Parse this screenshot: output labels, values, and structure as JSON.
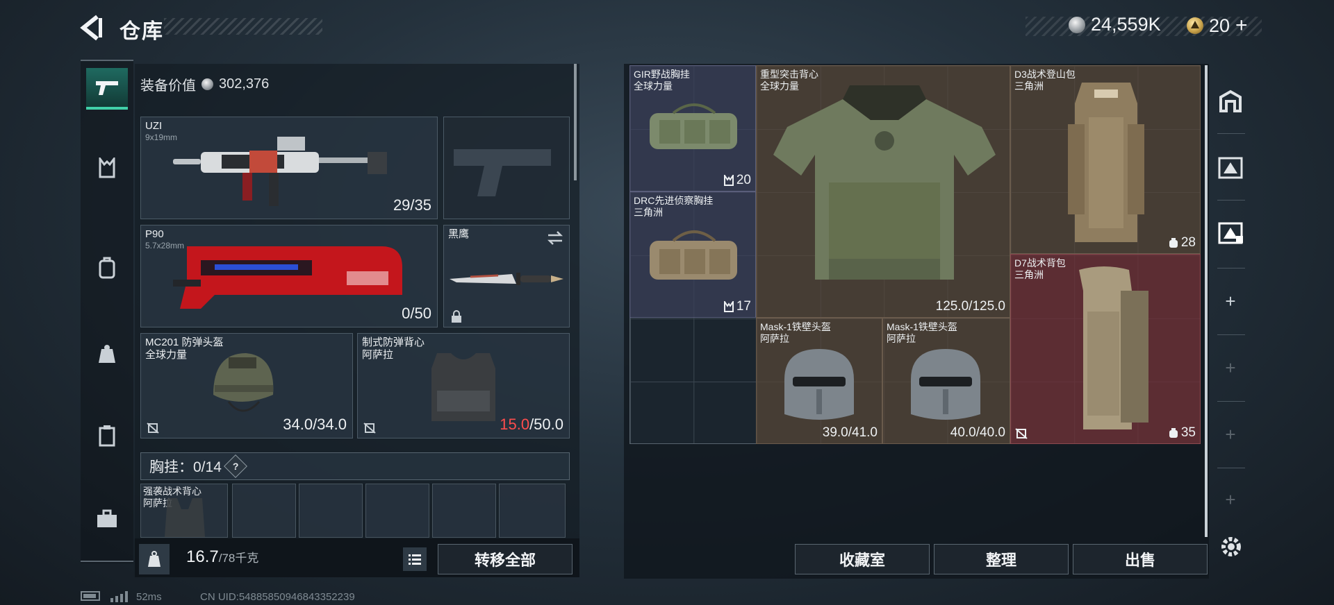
{
  "header": {
    "title": "仓库",
    "silver": "24,559K",
    "gold": "20",
    "plus": "+"
  },
  "left_nav": [
    "pistol-icon",
    "chest-rig-icon",
    "backpack-icon",
    "pouch-icon",
    "card-icon",
    "toolbox-icon"
  ],
  "equipment": {
    "value_label": "装备价值",
    "value": "302,376",
    "uzi": {
      "name": "UZI",
      "ammo": "9x19mm",
      "durability": "29/35"
    },
    "p90": {
      "name": "P90",
      "ammo": "5.7x28mm",
      "durability": "0/50"
    },
    "knife": {
      "name": "黑鹰"
    },
    "helmet": {
      "name": "MC201 防弹头盔",
      "faction": "全球力量",
      "durability": "34.0/34.0"
    },
    "armor": {
      "name": "制式防弹背心",
      "faction": "阿萨拉",
      "durability_cur": "15.0",
      "durability_max": "/50.0"
    },
    "vest_label": "胸挂：0/14",
    "vest_help": "?",
    "vest_item": {
      "name": "强袭战术背心",
      "faction": "阿萨拉"
    },
    "weight": "16.7",
    "weight_max": "/78千克",
    "transfer_all": "转移全部"
  },
  "storage": {
    "gir": {
      "name": "GIR野战胸挂",
      "faction": "全球力量",
      "count": "20"
    },
    "drc": {
      "name": "DRC先进侦察胸挂",
      "faction": "三角洲",
      "count": "17"
    },
    "heavy_vest": {
      "name": "重型突击背心",
      "faction": "全球力量",
      "durability": "125.0/125.0"
    },
    "d3": {
      "name": "D3战术登山包",
      "faction": "三角洲",
      "count": "28"
    },
    "d7": {
      "name": "D7战术背包",
      "faction": "三角洲",
      "count": "35"
    },
    "mask1": {
      "name": "Mask-1铁壁头盔",
      "faction": "阿萨拉",
      "durability": "39.0/41.0"
    },
    "mask2": {
      "name": "Mask-1铁壁头盔",
      "faction": "阿萨拉",
      "durability": "40.0/40.0"
    }
  },
  "actions": {
    "collection": "收藏室",
    "organize": "整理",
    "sell": "出售"
  },
  "right_nav": {
    "add": "+"
  },
  "footer": {
    "ping": "52ms",
    "uid": "CN UID:54885850946843352239"
  },
  "colors": {
    "accent": "#41d1a9",
    "damage": "#ff4d4d",
    "red_cell": "#6e3034",
    "blue_cell": "#3c405a",
    "brown_cell": "#584638"
  }
}
